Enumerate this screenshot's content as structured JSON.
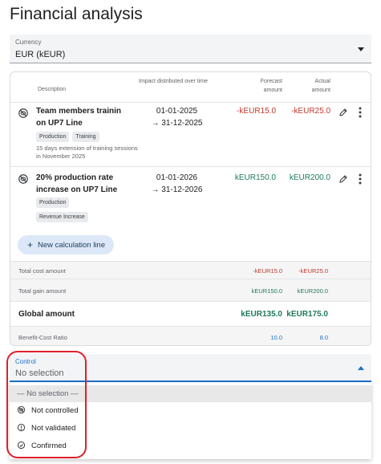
{
  "page": {
    "title": "Financial analysis"
  },
  "currency": {
    "label": "Currency",
    "value": "EUR (kEUR)"
  },
  "table": {
    "headers": {
      "description": "Description",
      "impact": "Impact distributed over time",
      "forecast": "Forecast amount",
      "actual": "Actual amount"
    },
    "lines": [
      {
        "title": "Team members trainin on UP7 Line",
        "tags": [
          "Production",
          "Training"
        ],
        "note": "15 days extension of training sessions in November 2025",
        "start": "01-01-2025",
        "end": "→ 31-12-2025",
        "forecast": "-kEUR15.0",
        "actual": "-kEUR25.0"
      },
      {
        "title": "20% production rate increase on UP7 Line",
        "tags": [
          "Production",
          "Revenue Increase"
        ],
        "note": "",
        "start": "01-01-2026",
        "end": "→ 31-12-2026",
        "forecast": "kEUR150.0",
        "actual": "kEUR200.0"
      }
    ],
    "add_button": "New calculation line",
    "summary": {
      "total_cost": {
        "label": "Total cost amount",
        "forecast": "-kEUR15.0",
        "actual": "-kEUR25.0"
      },
      "total_gain": {
        "label": "Total gain amount",
        "forecast": "kEUR150.0",
        "actual": "kEUR200.0"
      },
      "global": {
        "label": "Global amount",
        "forecast": "kEUR135.0",
        "actual": "kEUR175.0"
      },
      "ratio": {
        "label": "Benefit-Cost Ratio",
        "forecast": "10.0",
        "actual": "8.0"
      }
    }
  },
  "control": {
    "label": "Control",
    "value": "No selection",
    "options": [
      {
        "label": "— No selection —",
        "icon": ""
      },
      {
        "label": "Not controlled",
        "icon": "eye-off-icon"
      },
      {
        "label": "Not validated",
        "icon": "alert-circle-icon"
      },
      {
        "label": "Confirmed",
        "icon": "check-circle-icon"
      }
    ]
  },
  "colors": {
    "negative": "#c0392b",
    "positive": "#1e7a5a",
    "accent": "#1a73c8",
    "highlight": "#e01f2b"
  }
}
